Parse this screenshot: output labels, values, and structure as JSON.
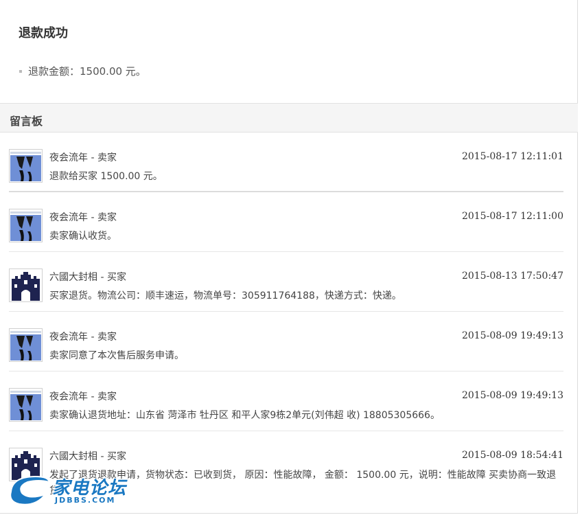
{
  "success": {
    "title": "退款成功",
    "refund_line": "退款金额：1500.00 元。"
  },
  "board": {
    "title": "留言板",
    "messages": [
      {
        "name": "夜会流年 - 卖家",
        "time": "2015-08-17 12:11:01",
        "text": "退款给买家 1500.00 元。",
        "avatar": "seller-avatar"
      },
      {
        "name": "夜会流年 - 卖家",
        "time": "2015-08-17 12:11:00",
        "text": "卖家确认收货。",
        "avatar": "seller-avatar"
      },
      {
        "name": "六國大封相 - 买家",
        "time": "2015-08-13 17:50:47",
        "text": "买家退货。物流公司：顺丰速运，物流单号：305911764188，快递方式：快递。",
        "avatar": "buyer-avatar"
      },
      {
        "name": "夜会流年 - 卖家",
        "time": "2015-08-09 19:49:13",
        "text": "卖家同意了本次售后服务申请。",
        "avatar": "seller-avatar"
      },
      {
        "name": "夜会流年 - 卖家",
        "time": "2015-08-09 19:49:13",
        "text": "卖家确认退货地址：山东省 菏泽市 牡丹区 和平人家9栋2单元(刘伟超 收) 18805305666。",
        "avatar": "seller-avatar"
      },
      {
        "name": "六國大封相 - 买家",
        "time": "2015-08-09 18:54:41",
        "text": "发起了退货退款申请，货物状态：已收到货， 原因：性能故障， 金额： 1500.00 元，说明：性能故障 买卖协商一致退货",
        "avatar": "buyer-avatar"
      }
    ]
  },
  "watermark": {
    "logo_text": "家电论坛",
    "logo_sub": "JDBBS.COM"
  },
  "colors": {
    "header_bg": "#f5f5f5",
    "buyer_avatar": "#1e2350",
    "seller_avatar_sky": "#6f8fd6",
    "watermark": "#1a78c2"
  }
}
